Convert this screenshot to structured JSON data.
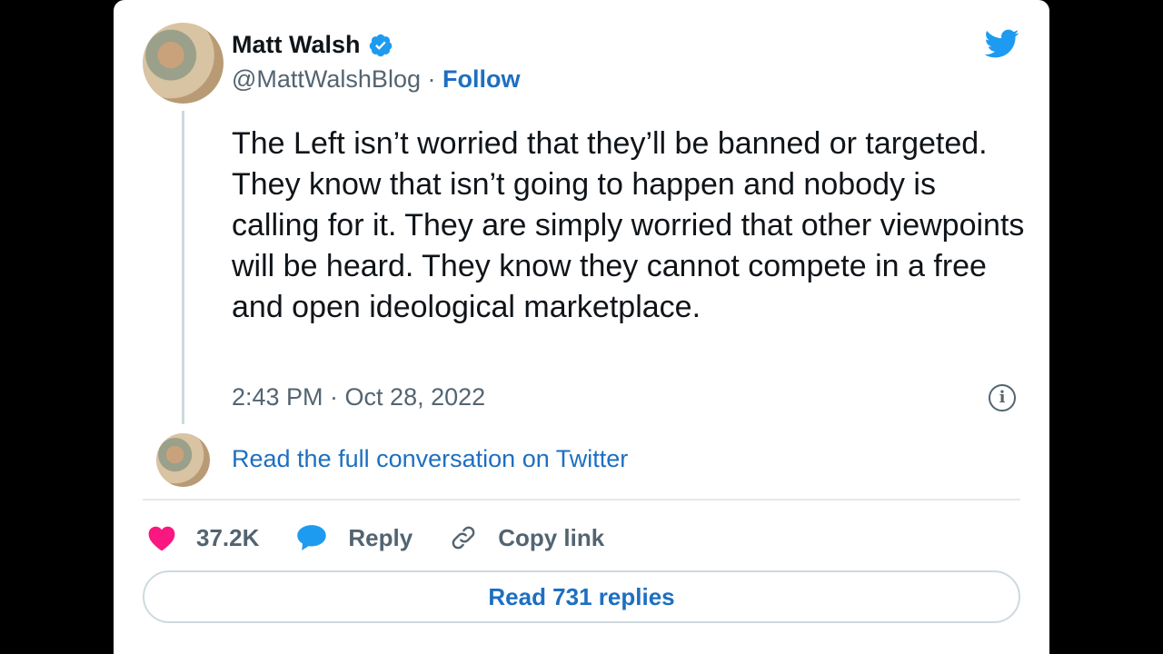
{
  "tweet": {
    "author_name": "Matt Walsh",
    "handle": "@MattWalshBlog",
    "separator": "·",
    "follow_label": "Follow",
    "text": "The Left isn’t worried that they’ll be banned or targeted. They know that isn’t going to happen and nobody is calling for it. They are simply worried that other viewpoints will be heard. They know they cannot compete in a free and open ideological marketplace.",
    "timestamp": "2:43 PM · Oct 28, 2022",
    "info_icon": "i"
  },
  "conversation": {
    "read_full_label": "Read the full conversation on Twitter"
  },
  "actions": {
    "likes_count": "37.2K",
    "reply_label": "Reply",
    "copy_link_label": "Copy link",
    "read_replies_label": "Read 731 replies"
  },
  "icons": {
    "verified": "verified-badge-icon",
    "brand": "twitter-bird-icon",
    "like": "heart-icon",
    "reply": "speech-bubble-icon",
    "copy": "link-icon",
    "info": "info-icon"
  },
  "colors": {
    "brand": "#1d9bf0",
    "link": "#1d6fc1",
    "heart": "#f91880",
    "reply": "#1d9bf0",
    "text": "#0f1419",
    "muted": "#536471",
    "background": "#000000"
  }
}
